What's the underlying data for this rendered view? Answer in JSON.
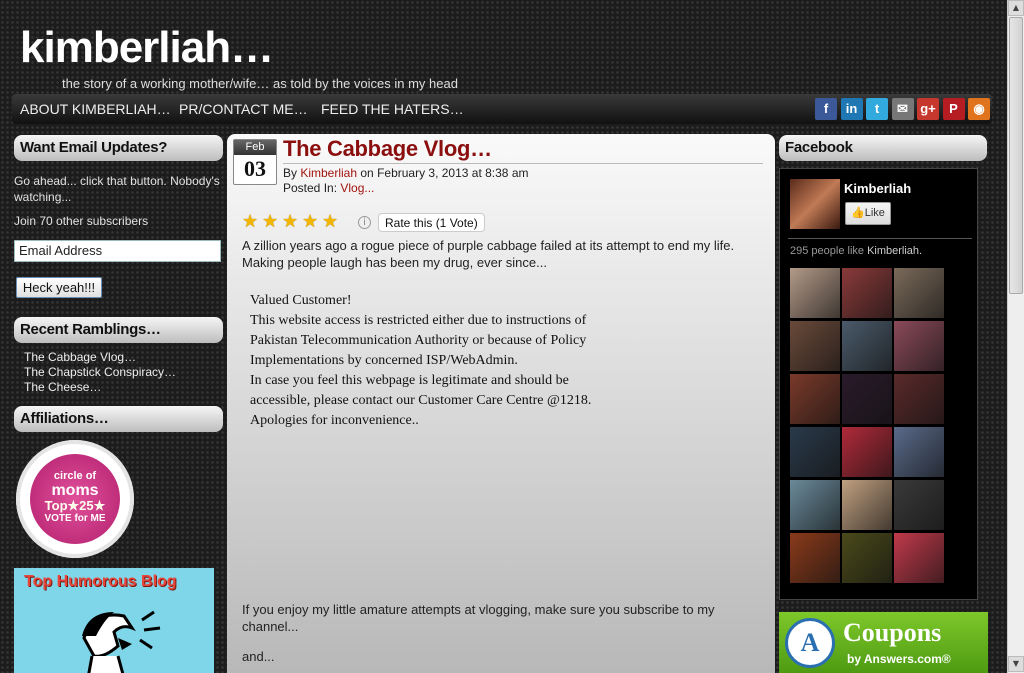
{
  "header": {
    "title": "kimberliah…",
    "tagline": "the story of a working mother/wife… as told by the voices in my head"
  },
  "nav": {
    "items": [
      "ABOUT KIMBERLIAH…",
      "PR/CONTACT ME…",
      "FEED THE HATERS…"
    ],
    "social": [
      {
        "icon": "facebook-icon",
        "glyph": "f",
        "color": "#3b5998"
      },
      {
        "icon": "linkedin-icon",
        "glyph": "in",
        "color": "#1f77b4"
      },
      {
        "icon": "twitter-icon",
        "glyph": "t",
        "color": "#33aadd"
      },
      {
        "icon": "email-icon",
        "glyph": "✉",
        "color": "#777777"
      },
      {
        "icon": "google-plus-icon",
        "glyph": "g+",
        "color": "#c6372d"
      },
      {
        "icon": "pinterest-icon",
        "glyph": "P",
        "color": "#b51d23"
      },
      {
        "icon": "rss-icon",
        "glyph": "◉",
        "color": "#e0731b"
      }
    ]
  },
  "sidebar": {
    "email_heading": "Want Email Updates?",
    "email_blurb": "Go ahead... click that button. Nobody's watching...",
    "subscribers": "Join 70 other subscribers",
    "email_placeholder": "Email Address",
    "subscribe_button": "Heck yeah!!!",
    "ramblings_heading": "Recent Ramblings…",
    "ramblings": [
      "The Cabbage Vlog…",
      "The Chapstick Conspiracy…",
      "The Cheese…"
    ],
    "affiliations_heading": "Affiliations…",
    "badge": {
      "line1": "circle of",
      "line2": "moms",
      "line3": "Top★25★",
      "line4": "VOTE for ME"
    },
    "humor_banner": "Top Humorous Blog"
  },
  "post": {
    "month": "Feb",
    "day": "03",
    "title": "The Cabbage Vlog…",
    "by_prefix": "By ",
    "author": "Kimberliah",
    "date_text": " on February 3, 2013 at 8:38 am",
    "posted_in": "Posted In: ",
    "category": "Vlog...",
    "rating": 5,
    "rate_button": "Rate this (1 Vote)",
    "intro": "A zillion years ago a rogue piece of purple cabbage failed at its attempt to end my life.  Making people laugh has been my drug, ever since...",
    "blocked_lines": [
      "Valued Customer!",
      "This website access is restricted either due to instructions of",
      "Pakistan Telecommunication Authority or because of Policy",
      "Implementations by concerned ISP/WebAdmin.",
      "In case you feel this webpage is legitimate and should be",
      "accessible, please contact our Customer Care Centre @1218.",
      "Apologies for inconvenience.."
    ],
    "outro": "If you enjoy my little amature attempts at vlogging, make sure you subscribe to my channel...",
    "and": "and..."
  },
  "facebook": {
    "heading": "Facebook",
    "name": "Kimberliah",
    "like_label": "Like",
    "count_prefix": "295 people like ",
    "count_name": "Kimberliah.",
    "fan_colors": [
      "#b39a88",
      "#8a3a3a",
      "#7a6a5a",
      "#6a4a3a",
      "#4a5a6a",
      "#8a4a5a",
      "#7a3a2a",
      "#2a1a2a",
      "#5a2a2a",
      "#2a3a4a",
      "#b02a3a",
      "#5a6a8a",
      "#6a8a9a",
      "#c0a080",
      "#3a3a3a",
      "#8a3a1a",
      "#4a4a1a",
      "#c03a4a"
    ]
  },
  "ad": {
    "logo": "A",
    "title": "Coupons",
    "sub": "by Answers.com®"
  }
}
